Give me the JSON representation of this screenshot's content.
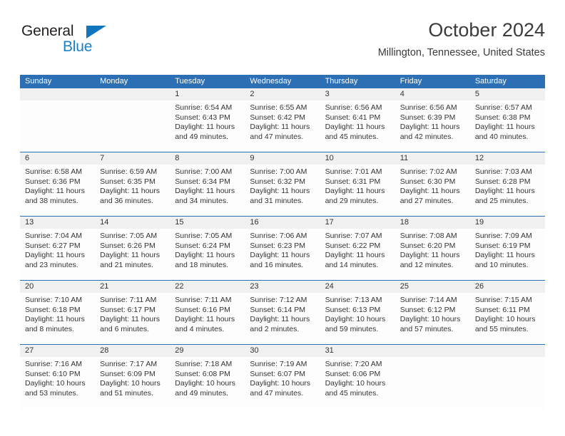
{
  "brand": {
    "name_part1": "General",
    "name_part2": "Blue",
    "triangle_color": "#1175bd",
    "blue_color": "#1a81c8"
  },
  "header": {
    "title": "October 2024",
    "subtitle": "Millington, Tennessee, United States"
  },
  "theme": {
    "header_blue": "#2c6fb5",
    "day_band_gray": "#f0f0f0",
    "text_color": "#333333"
  },
  "weekdays": [
    "Sunday",
    "Monday",
    "Tuesday",
    "Wednesday",
    "Thursday",
    "Friday",
    "Saturday"
  ],
  "weeks": [
    [
      {
        "day": "",
        "sunrise": "",
        "sunset": "",
        "daylight1": "",
        "daylight2": ""
      },
      {
        "day": "",
        "sunrise": "",
        "sunset": "",
        "daylight1": "",
        "daylight2": ""
      },
      {
        "day": "1",
        "sunrise": "Sunrise: 6:54 AM",
        "sunset": "Sunset: 6:43 PM",
        "daylight1": "Daylight: 11 hours",
        "daylight2": "and 49 minutes."
      },
      {
        "day": "2",
        "sunrise": "Sunrise: 6:55 AM",
        "sunset": "Sunset: 6:42 PM",
        "daylight1": "Daylight: 11 hours",
        "daylight2": "and 47 minutes."
      },
      {
        "day": "3",
        "sunrise": "Sunrise: 6:56 AM",
        "sunset": "Sunset: 6:41 PM",
        "daylight1": "Daylight: 11 hours",
        "daylight2": "and 45 minutes."
      },
      {
        "day": "4",
        "sunrise": "Sunrise: 6:56 AM",
        "sunset": "Sunset: 6:39 PM",
        "daylight1": "Daylight: 11 hours",
        "daylight2": "and 42 minutes."
      },
      {
        "day": "5",
        "sunrise": "Sunrise: 6:57 AM",
        "sunset": "Sunset: 6:38 PM",
        "daylight1": "Daylight: 11 hours",
        "daylight2": "and 40 minutes."
      }
    ],
    [
      {
        "day": "6",
        "sunrise": "Sunrise: 6:58 AM",
        "sunset": "Sunset: 6:36 PM",
        "daylight1": "Daylight: 11 hours",
        "daylight2": "and 38 minutes."
      },
      {
        "day": "7",
        "sunrise": "Sunrise: 6:59 AM",
        "sunset": "Sunset: 6:35 PM",
        "daylight1": "Daylight: 11 hours",
        "daylight2": "and 36 minutes."
      },
      {
        "day": "8",
        "sunrise": "Sunrise: 7:00 AM",
        "sunset": "Sunset: 6:34 PM",
        "daylight1": "Daylight: 11 hours",
        "daylight2": "and 34 minutes."
      },
      {
        "day": "9",
        "sunrise": "Sunrise: 7:00 AM",
        "sunset": "Sunset: 6:32 PM",
        "daylight1": "Daylight: 11 hours",
        "daylight2": "and 31 minutes."
      },
      {
        "day": "10",
        "sunrise": "Sunrise: 7:01 AM",
        "sunset": "Sunset: 6:31 PM",
        "daylight1": "Daylight: 11 hours",
        "daylight2": "and 29 minutes."
      },
      {
        "day": "11",
        "sunrise": "Sunrise: 7:02 AM",
        "sunset": "Sunset: 6:30 PM",
        "daylight1": "Daylight: 11 hours",
        "daylight2": "and 27 minutes."
      },
      {
        "day": "12",
        "sunrise": "Sunrise: 7:03 AM",
        "sunset": "Sunset: 6:28 PM",
        "daylight1": "Daylight: 11 hours",
        "daylight2": "and 25 minutes."
      }
    ],
    [
      {
        "day": "13",
        "sunrise": "Sunrise: 7:04 AM",
        "sunset": "Sunset: 6:27 PM",
        "daylight1": "Daylight: 11 hours",
        "daylight2": "and 23 minutes."
      },
      {
        "day": "14",
        "sunrise": "Sunrise: 7:05 AM",
        "sunset": "Sunset: 6:26 PM",
        "daylight1": "Daylight: 11 hours",
        "daylight2": "and 21 minutes."
      },
      {
        "day": "15",
        "sunrise": "Sunrise: 7:05 AM",
        "sunset": "Sunset: 6:24 PM",
        "daylight1": "Daylight: 11 hours",
        "daylight2": "and 18 minutes."
      },
      {
        "day": "16",
        "sunrise": "Sunrise: 7:06 AM",
        "sunset": "Sunset: 6:23 PM",
        "daylight1": "Daylight: 11 hours",
        "daylight2": "and 16 minutes."
      },
      {
        "day": "17",
        "sunrise": "Sunrise: 7:07 AM",
        "sunset": "Sunset: 6:22 PM",
        "daylight1": "Daylight: 11 hours",
        "daylight2": "and 14 minutes."
      },
      {
        "day": "18",
        "sunrise": "Sunrise: 7:08 AM",
        "sunset": "Sunset: 6:20 PM",
        "daylight1": "Daylight: 11 hours",
        "daylight2": "and 12 minutes."
      },
      {
        "day": "19",
        "sunrise": "Sunrise: 7:09 AM",
        "sunset": "Sunset: 6:19 PM",
        "daylight1": "Daylight: 11 hours",
        "daylight2": "and 10 minutes."
      }
    ],
    [
      {
        "day": "20",
        "sunrise": "Sunrise: 7:10 AM",
        "sunset": "Sunset: 6:18 PM",
        "daylight1": "Daylight: 11 hours",
        "daylight2": "and 8 minutes."
      },
      {
        "day": "21",
        "sunrise": "Sunrise: 7:11 AM",
        "sunset": "Sunset: 6:17 PM",
        "daylight1": "Daylight: 11 hours",
        "daylight2": "and 6 minutes."
      },
      {
        "day": "22",
        "sunrise": "Sunrise: 7:11 AM",
        "sunset": "Sunset: 6:16 PM",
        "daylight1": "Daylight: 11 hours",
        "daylight2": "and 4 minutes."
      },
      {
        "day": "23",
        "sunrise": "Sunrise: 7:12 AM",
        "sunset": "Sunset: 6:14 PM",
        "daylight1": "Daylight: 11 hours",
        "daylight2": "and 2 minutes."
      },
      {
        "day": "24",
        "sunrise": "Sunrise: 7:13 AM",
        "sunset": "Sunset: 6:13 PM",
        "daylight1": "Daylight: 10 hours",
        "daylight2": "and 59 minutes."
      },
      {
        "day": "25",
        "sunrise": "Sunrise: 7:14 AM",
        "sunset": "Sunset: 6:12 PM",
        "daylight1": "Daylight: 10 hours",
        "daylight2": "and 57 minutes."
      },
      {
        "day": "26",
        "sunrise": "Sunrise: 7:15 AM",
        "sunset": "Sunset: 6:11 PM",
        "daylight1": "Daylight: 10 hours",
        "daylight2": "and 55 minutes."
      }
    ],
    [
      {
        "day": "27",
        "sunrise": "Sunrise: 7:16 AM",
        "sunset": "Sunset: 6:10 PM",
        "daylight1": "Daylight: 10 hours",
        "daylight2": "and 53 minutes."
      },
      {
        "day": "28",
        "sunrise": "Sunrise: 7:17 AM",
        "sunset": "Sunset: 6:09 PM",
        "daylight1": "Daylight: 10 hours",
        "daylight2": "and 51 minutes."
      },
      {
        "day": "29",
        "sunrise": "Sunrise: 7:18 AM",
        "sunset": "Sunset: 6:08 PM",
        "daylight1": "Daylight: 10 hours",
        "daylight2": "and 49 minutes."
      },
      {
        "day": "30",
        "sunrise": "Sunrise: 7:19 AM",
        "sunset": "Sunset: 6:07 PM",
        "daylight1": "Daylight: 10 hours",
        "daylight2": "and 47 minutes."
      },
      {
        "day": "31",
        "sunrise": "Sunrise: 7:20 AM",
        "sunset": "Sunset: 6:06 PM",
        "daylight1": "Daylight: 10 hours",
        "daylight2": "and 45 minutes."
      },
      {
        "day": "",
        "sunrise": "",
        "sunset": "",
        "daylight1": "",
        "daylight2": ""
      },
      {
        "day": "",
        "sunrise": "",
        "sunset": "",
        "daylight1": "",
        "daylight2": ""
      }
    ]
  ]
}
